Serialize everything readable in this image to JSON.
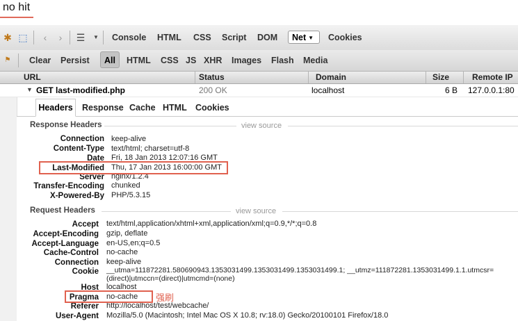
{
  "caption": "no hit",
  "note": "强刷",
  "main_tabs": [
    "Console",
    "HTML",
    "CSS",
    "Script",
    "DOM",
    "Net",
    "Cookies"
  ],
  "filter_bar": {
    "clear": "Clear",
    "persist": "Persist",
    "filters": [
      "All",
      "HTML",
      "CSS",
      "JS",
      "XHR",
      "Images",
      "Flash",
      "Media"
    ]
  },
  "columns": [
    "URL",
    "Status",
    "Domain",
    "Size",
    "Remote IP"
  ],
  "request": {
    "url": "GET last-modified.php",
    "status": "200 OK",
    "domain": "localhost",
    "size": "6 B",
    "remote_ip": "127.0.0.1:80"
  },
  "detail_tabs": [
    "Headers",
    "Response",
    "Cache",
    "HTML",
    "Cookies"
  ],
  "response_headers": {
    "title": "Response Headers",
    "view_source": "view source",
    "items": [
      {
        "name": "Connection",
        "value": "keep-alive"
      },
      {
        "name": "Content-Type",
        "value": "text/html; charset=utf-8"
      },
      {
        "name": "Date",
        "value": "Fri, 18 Jan 2013 12:07:16 GMT"
      },
      {
        "name": "Last-Modified",
        "value": "Thu, 17 Jan 2013 16:00:00 GMT"
      },
      {
        "name": "Server",
        "value": "nginx/1.2.4"
      },
      {
        "name": "Transfer-Encoding",
        "value": "chunked"
      },
      {
        "name": "X-Powered-By",
        "value": "PHP/5.3.15"
      }
    ]
  },
  "request_headers": {
    "title": "Request Headers",
    "view_source": "view source",
    "items": [
      {
        "name": "Accept",
        "value": "text/html,application/xhtml+xml,application/xml;q=0.9,*/*;q=0.8"
      },
      {
        "name": "Accept-Encoding",
        "value": "gzip, deflate"
      },
      {
        "name": "Accept-Language",
        "value": "en-US,en;q=0.5"
      },
      {
        "name": "Cache-Control",
        "value": "no-cache"
      },
      {
        "name": "Connection",
        "value": "keep-alive"
      },
      {
        "name": "Cookie",
        "value": "__utma=111872281.580690943.1353031499.1353031499.1353031499.1; __utmz=111872281.1353031499.1.1.utmcsr=(direct)|utmccn=(direct)|utmcmd=(none)"
      },
      {
        "name": "Host",
        "value": "localhost"
      },
      {
        "name": "Pragma",
        "value": "no-cache"
      },
      {
        "name": "Referer",
        "value": "http://localhost/test/webcache/"
      },
      {
        "name": "User-Agent",
        "value": "Mozilla/5.0 (Macintosh; Intel Mac OS X 10.8; rv:18.0) Gecko/20100101 Firefox/18.0"
      }
    ]
  },
  "colors": {
    "highlight": "#e0614f",
    "caption_underline": "#e06a5a"
  }
}
